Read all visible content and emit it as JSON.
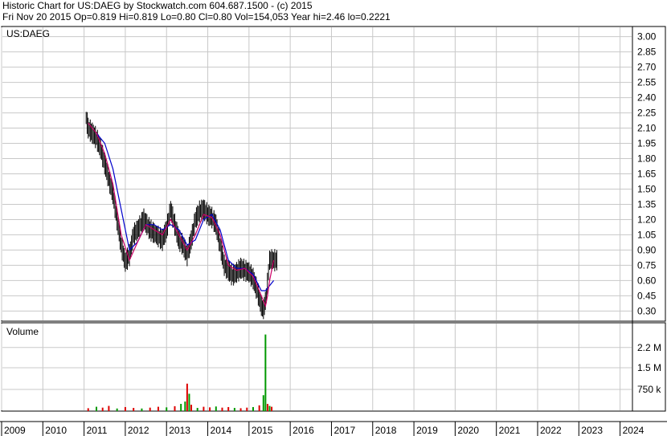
{
  "header": {
    "line1": "Historic Chart for US:DAEG by Stockwatch.com 604.687.1500 - (c) 2015",
    "line2": "Fri Nov 20 2015   Op=0.819   Hi=0.819   Lo=0.80   Cl=0.80   Vol=154,053   Year hi=2.46   lo=0.2221"
  },
  "colors": {
    "price": "#000000",
    "ma_fast": "#cc0066",
    "ma_slow": "#0000cc",
    "vol_down": "#dd0000",
    "vol_up": "#009900",
    "grid": "#c8c8c8"
  },
  "chart_data": [
    {
      "type": "line",
      "title": "US:DAEG",
      "ylim": [
        0.2,
        3.1
      ],
      "y_ticks": [
        "3.00",
        "2.85",
        "2.70",
        "2.55",
        "2.40",
        "2.25",
        "2.10",
        "1.95",
        "1.80",
        "1.65",
        "1.50",
        "1.35",
        "1.20",
        "1.05",
        "0.90",
        "0.75",
        "0.60",
        "0.45",
        "0.30"
      ],
      "series": [
        {
          "key": "close",
          "x": [
            2011.05,
            2011.1,
            2011.2,
            2011.3,
            2011.4,
            2011.5,
            2011.6,
            2011.7,
            2011.8,
            2011.9,
            2012.0,
            2012.1,
            2012.2,
            2012.3,
            2012.45,
            2012.6,
            2012.75,
            2012.9,
            2013.0,
            2013.1,
            2013.2,
            2013.3,
            2013.4,
            2013.5,
            2013.6,
            2013.7,
            2013.8,
            2013.9,
            2014.0,
            2014.1,
            2014.2,
            2014.3,
            2014.4,
            2014.5,
            2014.6,
            2014.7,
            2014.8,
            2014.9,
            2015.0,
            2015.1,
            2015.2,
            2015.3,
            2015.35,
            2015.42,
            2015.5,
            2015.55,
            2015.6,
            2015.7
          ],
          "values": [
            2.2,
            2.1,
            2.05,
            2.0,
            1.9,
            1.75,
            1.6,
            1.45,
            1.2,
            0.95,
            0.78,
            0.85,
            1.05,
            1.1,
            1.2,
            1.1,
            1.05,
            1.0,
            1.1,
            1.3,
            1.15,
            1.0,
            0.95,
            0.85,
            1.0,
            1.2,
            1.28,
            1.3,
            1.25,
            1.22,
            1.15,
            0.95,
            0.75,
            0.7,
            0.65,
            0.68,
            0.72,
            0.7,
            0.68,
            0.62,
            0.5,
            0.35,
            0.3,
            0.45,
            0.8,
            0.8,
            0.8,
            0.8
          ]
        },
        {
          "key": "ma_fast",
          "x": [
            2011.1,
            2011.3,
            2011.5,
            2011.7,
            2011.9,
            2012.1,
            2012.3,
            2012.5,
            2012.7,
            2012.9,
            2013.1,
            2013.3,
            2013.5,
            2013.7,
            2013.9,
            2014.1,
            2014.3,
            2014.5,
            2014.7,
            2014.9,
            2015.1,
            2015.3,
            2015.4,
            2015.45,
            2015.5,
            2015.6
          ],
          "values": [
            2.15,
            2.05,
            1.85,
            1.55,
            1.05,
            0.8,
            0.98,
            1.15,
            1.1,
            1.05,
            1.2,
            1.05,
            0.9,
            1.05,
            1.25,
            1.22,
            1.05,
            0.75,
            0.7,
            0.72,
            0.64,
            0.45,
            0.35,
            0.45,
            0.6,
            0.8
          ]
        },
        {
          "key": "ma_slow",
          "x": [
            2011.3,
            2011.5,
            2011.7,
            2011.9,
            2012.1,
            2012.3,
            2012.5,
            2012.7,
            2012.9,
            2013.1,
            2013.3,
            2013.5,
            2013.7,
            2013.9,
            2014.1,
            2014.3,
            2014.5,
            2014.7,
            2014.9,
            2015.1,
            2015.3,
            2015.4,
            2015.5,
            2015.6
          ],
          "values": [
            2.05,
            1.95,
            1.7,
            1.3,
            0.9,
            0.98,
            1.15,
            1.15,
            1.1,
            1.15,
            1.1,
            0.95,
            1.0,
            1.2,
            1.25,
            1.1,
            0.8,
            0.72,
            0.72,
            0.66,
            0.5,
            0.5,
            0.55,
            0.6
          ]
        }
      ]
    },
    {
      "type": "bar",
      "title": "Volume",
      "y_ticks": [
        "2.2 M",
        "1.5 M",
        "750 k"
      ],
      "ylim": [
        0,
        3000000
      ],
      "x": [
        2011.1,
        2011.3,
        2011.45,
        2011.6,
        2011.8,
        2012.0,
        2012.2,
        2012.4,
        2012.6,
        2012.8,
        2013.0,
        2013.2,
        2013.35,
        2013.45,
        2013.5,
        2013.55,
        2013.6,
        2013.75,
        2013.9,
        2014.05,
        2014.2,
        2014.35,
        2014.5,
        2014.65,
        2014.8,
        2014.95,
        2015.1,
        2015.25,
        2015.35,
        2015.4,
        2015.45,
        2015.5,
        2015.55
      ],
      "values": [
        100000,
        150000,
        120000,
        180000,
        90000,
        140000,
        110000,
        90000,
        120000,
        150000,
        130000,
        170000,
        250000,
        330000,
        950000,
        600000,
        220000,
        110000,
        150000,
        130000,
        160000,
        120000,
        140000,
        110000,
        100000,
        120000,
        140000,
        200000,
        550000,
        2650000,
        250000,
        180000,
        150000
      ],
      "up": [
        false,
        true,
        false,
        false,
        true,
        false,
        false,
        true,
        false,
        false,
        true,
        false,
        true,
        true,
        false,
        true,
        false,
        true,
        false,
        false,
        true,
        false,
        false,
        true,
        false,
        false,
        true,
        false,
        true,
        true,
        false,
        true,
        false
      ]
    }
  ],
  "x_axis": {
    "years": [
      "2009",
      "2010",
      "2011",
      "2012",
      "2013",
      "2014",
      "2015",
      "2016",
      "2017",
      "2018",
      "2019",
      "2020",
      "2021",
      "2022",
      "2023",
      "2024"
    ]
  }
}
